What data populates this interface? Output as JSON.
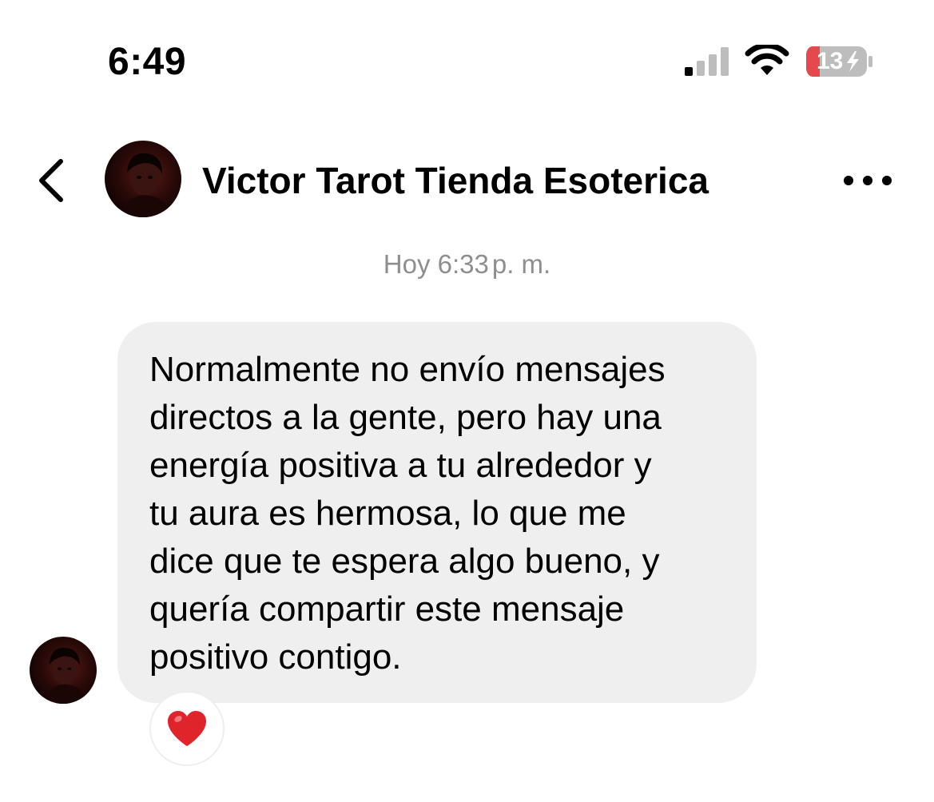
{
  "status_bar": {
    "time": "6:49",
    "battery_level": "13",
    "icons": [
      "cellular-signal-icon",
      "wifi-icon",
      "battery-charging-icon"
    ]
  },
  "header": {
    "contact_name": "Victor Tarot Tienda Esoterica",
    "icons": [
      "back-chevron-icon",
      "more-options-icon"
    ]
  },
  "conversation": {
    "timestamp_day": "Hoy",
    "timestamp_time": "6:33",
    "timestamp_period": "p. m.",
    "message": {
      "text": "Normalmente no envío mensajes\ndirectos a la gente, pero hay una\nenergía positiva a tu alrededor y\ntu aura es hermosa, lo que me\ndice que te espera algo bueno, y\nquería compartir este mensaje\npositivo contigo.",
      "reaction": "heart-emoji"
    }
  },
  "colors": {
    "bubble_background": "#efefef",
    "timestamp_text": "#8e8e8e",
    "battery_low": "#e5484d",
    "heart": "#e0242c"
  }
}
